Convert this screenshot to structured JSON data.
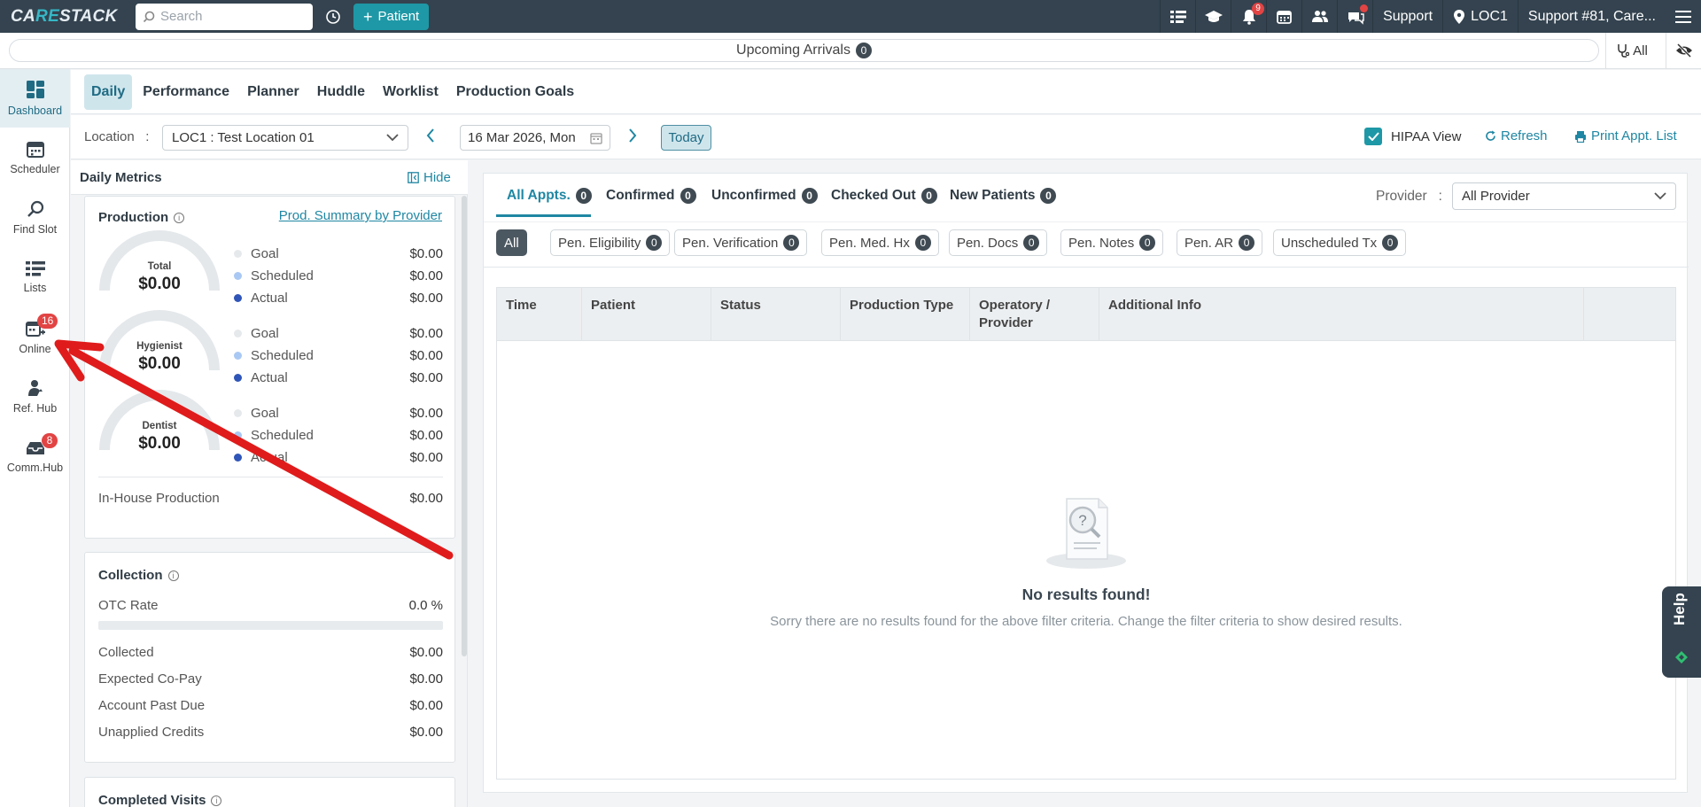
{
  "topbar": {
    "logo": "CARESTACK",
    "search_placeholder": "Search",
    "add_patient_label": "Patient",
    "notifications_count": "9",
    "support_label": "Support",
    "location_label": "LOC1",
    "account_label": "Support #81, Care..."
  },
  "arrivals": {
    "label": "Upcoming Arrivals",
    "count": "0",
    "filter_label": "All"
  },
  "leftnav": {
    "items": [
      {
        "label": "Dashboard",
        "icon": "dashboard-icon"
      },
      {
        "label": "Scheduler",
        "icon": "calendar-icon"
      },
      {
        "label": "Find Slot",
        "icon": "search-icon"
      },
      {
        "label": "Lists",
        "icon": "list-icon"
      },
      {
        "label": "Online",
        "icon": "online-calendar-icon",
        "badge": "16"
      },
      {
        "label": "Ref. Hub",
        "icon": "referral-icon"
      },
      {
        "label": "Comm.Hub",
        "icon": "inbox-icon",
        "badge": "8"
      }
    ]
  },
  "tabs": [
    "Daily",
    "Performance",
    "Planner",
    "Huddle",
    "Worklist",
    "Production Goals"
  ],
  "filters": {
    "location_label": "Location",
    "location_sep": ":",
    "location_value": "LOC1 : Test Location 01",
    "date_value": "16 Mar 2026, Mon",
    "today_label": "Today",
    "hipaa_label": "HIPAA View",
    "refresh_label": "Refresh",
    "print_label": "Print Appt. List"
  },
  "metrics": {
    "title": "Daily Metrics",
    "hide_label": "Hide",
    "production": {
      "title": "Production",
      "link": "Prod. Summary by Provider",
      "gauges": [
        {
          "label": "Total",
          "value": "$0.00",
          "goal": "$0.00",
          "scheduled": "$0.00",
          "actual": "$0.00"
        },
        {
          "label": "Hygienist",
          "value": "$0.00",
          "goal": "$0.00",
          "scheduled": "$0.00",
          "actual": "$0.00"
        },
        {
          "label": "Dentist",
          "value": "$0.00",
          "goal": "$0.00",
          "scheduled": "$0.00",
          "actual": "$0.00"
        }
      ],
      "legend": {
        "goal": "Goal",
        "scheduled": "Scheduled",
        "actual": "Actual"
      },
      "in_house_label": "In-House Production",
      "in_house_value": "$0.00"
    },
    "collection": {
      "title": "Collection",
      "otc_label": "OTC Rate",
      "otc_value": "0.0 %",
      "otc_fraction": 0,
      "rows": [
        {
          "label": "Collected",
          "value": "$0.00"
        },
        {
          "label": "Expected Co-Pay",
          "value": "$0.00"
        },
        {
          "label": "Account Past Due",
          "value": "$0.00"
        },
        {
          "label": "Unapplied Credits",
          "value": "$0.00"
        }
      ]
    },
    "completed_visits_title": "Completed Visits"
  },
  "appointments": {
    "tabs": [
      {
        "label": "All Appts.",
        "count": "0"
      },
      {
        "label": "Confirmed",
        "count": "0"
      },
      {
        "label": "Unconfirmed",
        "count": "0"
      },
      {
        "label": "Checked Out",
        "count": "0"
      },
      {
        "label": "New Patients",
        "count": "0"
      }
    ],
    "provider_label": "Provider",
    "provider_sep": ":",
    "provider_value": "All Provider",
    "chips": [
      {
        "label": "All"
      },
      {
        "label": "Pen. Eligibility",
        "count": "0"
      },
      {
        "label": "Pen. Verification",
        "count": "0"
      },
      {
        "label": "Pen. Med. Hx",
        "count": "0"
      },
      {
        "label": "Pen. Docs",
        "count": "0"
      },
      {
        "label": "Pen. Notes",
        "count": "0"
      },
      {
        "label": "Pen. AR",
        "count": "0"
      },
      {
        "label": "Unscheduled Tx",
        "count": "0"
      }
    ],
    "columns": [
      "Time",
      "Patient",
      "Status",
      "Production Type",
      "Operatory / Provider",
      "Additional Info"
    ],
    "empty_title": "No results found!",
    "empty_subtitle": "Sorry there are no results found for the above filter criteria. Change the filter criteria to show desired results."
  },
  "help_label": "Help",
  "colors": {
    "topbar": "#34434f",
    "accent": "#1e98a6",
    "link": "#1f87a3",
    "badge": "#e24444",
    "arrow": "#e01b1b"
  }
}
